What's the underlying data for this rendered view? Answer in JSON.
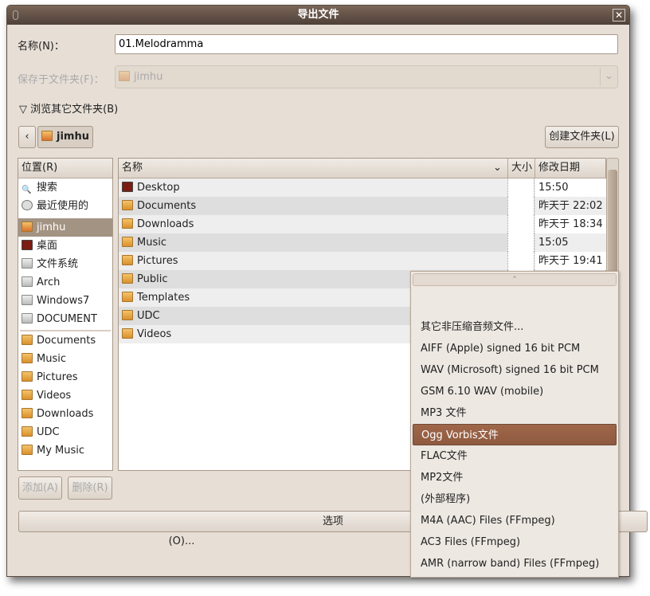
{
  "window": {
    "title": "导出文件"
  },
  "name_label": "名称(N)：",
  "name_value": "01.Melodramma",
  "folder_label": "保存于文件夹(F)：",
  "folder_value": "jimhu",
  "browse_label": "浏览其它文件夹(B)",
  "path": {
    "current": "jimhu"
  },
  "create_folder": "创建文件夹(L)",
  "places": {
    "header": "位置(R)",
    "items": [
      {
        "label": "搜索",
        "icon": "search-icon"
      },
      {
        "label": "最近使用的",
        "icon": "clock-icon"
      },
      {
        "label": "jimhu",
        "icon": "home-folder-icon",
        "selected": true
      },
      {
        "label": "桌面",
        "icon": "desktop-icon"
      },
      {
        "label": "文件系统",
        "icon": "drive-icon"
      },
      {
        "label": "Arch",
        "icon": "drive-icon"
      },
      {
        "label": "Windows7",
        "icon": "drive-icon"
      },
      {
        "label": "DOCUMENT",
        "icon": "drive-icon"
      }
    ],
    "bookmarks": [
      {
        "label": "Documents"
      },
      {
        "label": "Music"
      },
      {
        "label": "Pictures"
      },
      {
        "label": "Videos"
      },
      {
        "label": "Downloads"
      },
      {
        "label": "UDC"
      },
      {
        "label": "My Music"
      }
    ]
  },
  "files": {
    "columns": {
      "name": "名称",
      "size": "大小",
      "modified": "修改日期"
    },
    "rows": [
      {
        "name": "Desktop",
        "modified": "15:50",
        "icon": "desktop-icon"
      },
      {
        "name": "Documents",
        "modified": "昨天于 22:02",
        "icon": "folder-icon"
      },
      {
        "name": "Downloads",
        "modified": "昨天于 18:34",
        "icon": "folder-icon"
      },
      {
        "name": "Music",
        "modified": "15:05",
        "icon": "folder-icon"
      },
      {
        "name": "Pictures",
        "modified": "昨天于 19:41",
        "icon": "folder-icon"
      },
      {
        "name": "Public",
        "modified": "",
        "icon": "folder-icon"
      },
      {
        "name": "Templates",
        "modified": "",
        "icon": "folder-icon"
      },
      {
        "name": "UDC",
        "modified": "",
        "icon": "folder-icon"
      },
      {
        "name": "Videos",
        "modified": "",
        "icon": "folder-icon"
      }
    ]
  },
  "add_button": "添加(A)",
  "remove_button": "删除(R)",
  "options_button": "选项(O)...",
  "format_menu": {
    "items": [
      "其它非压缩音频文件...",
      "AIFF (Apple) signed 16 bit PCM",
      "WAV (Microsoft) signed 16 bit PCM",
      "GSM 6.10 WAV (mobile)",
      "MP3 文件",
      "Ogg Vorbis文件",
      "FLAC文件",
      "MP2文件",
      "(外部程序)",
      "M4A (AAC) Files (FFmpeg)",
      "AC3 Files (FFmpeg)",
      "AMR (narrow band) Files (FFmpeg)"
    ],
    "selected": "Ogg Vorbis文件",
    "highlight_color": "#a0674a"
  }
}
